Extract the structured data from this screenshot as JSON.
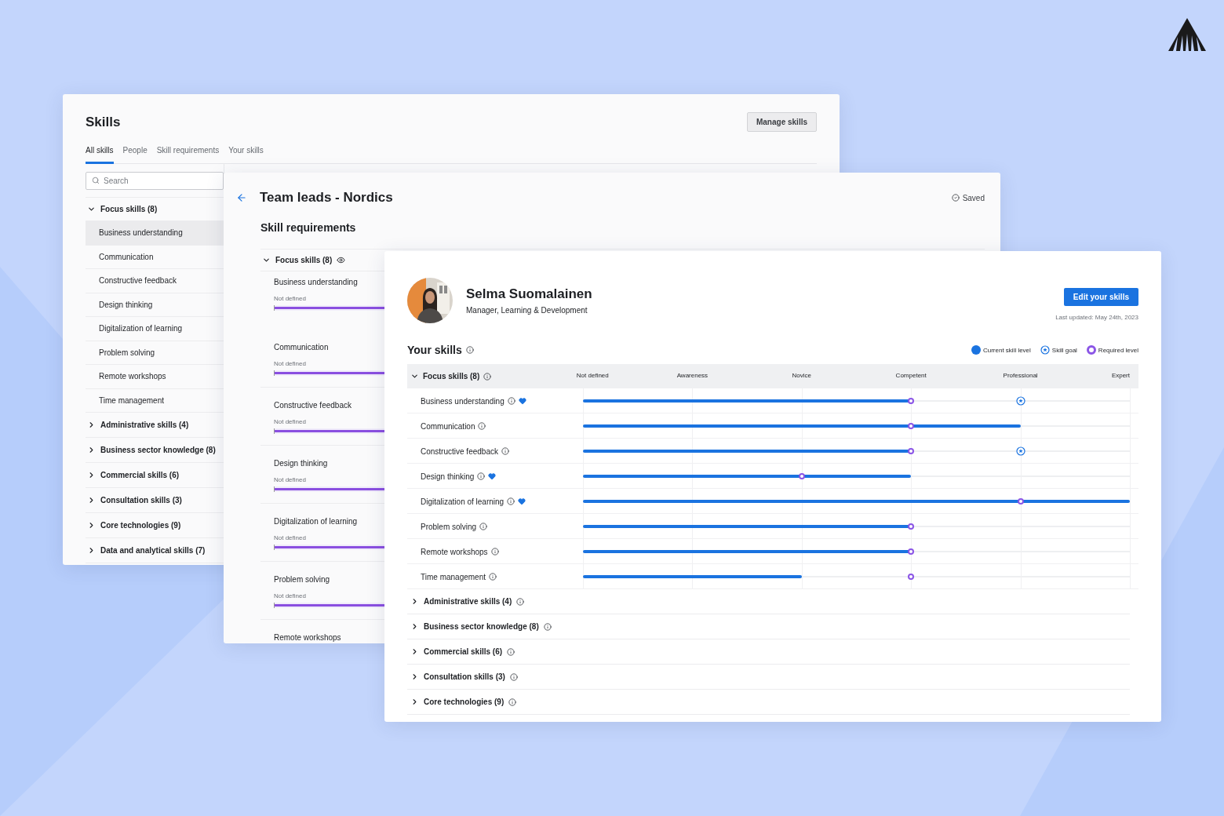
{
  "skills_window": {
    "title": "Skills",
    "manage_button": "Manage skills",
    "tabs": [
      {
        "label": "All skills",
        "selected": true
      },
      {
        "label": "People",
        "selected": false
      },
      {
        "label": "Skill requirements",
        "selected": false
      },
      {
        "label": "Your skills",
        "selected": false
      }
    ],
    "search": {
      "placeholder": "Search"
    },
    "groups": [
      {
        "label": "Focus skills (8)",
        "expanded": true,
        "items": [
          {
            "label": "Business understanding",
            "selected": true
          },
          {
            "label": "Communication",
            "selected": false
          },
          {
            "label": "Constructive feedback",
            "selected": false
          },
          {
            "label": "Design thinking",
            "selected": false
          },
          {
            "label": "Digitalization of learning",
            "selected": false
          },
          {
            "label": "Problem solving",
            "selected": false
          },
          {
            "label": "Remote workshops",
            "selected": false
          },
          {
            "label": "Time management",
            "selected": false
          }
        ]
      },
      {
        "label": "Administrative skills (4)",
        "expanded": false
      },
      {
        "label": "Business sector knowledge (8)",
        "expanded": false
      },
      {
        "label": "Commercial skills (6)",
        "expanded": false
      },
      {
        "label": "Consultation skills (3)",
        "expanded": false
      },
      {
        "label": "Core technologies (9)",
        "expanded": false
      },
      {
        "label": "Data and analytical skills (7)",
        "expanded": false
      }
    ]
  },
  "requirements_window": {
    "title": "Team leads - Nordics",
    "status": "Saved",
    "subtitle": "Skill requirements",
    "group": {
      "label": "Focus skills (8)",
      "expanded": true
    },
    "items": [
      {
        "name": "Business understanding",
        "value": "Not defined",
        "level": 1
      },
      {
        "name": "Communication",
        "value": "Not defined",
        "level": 1
      },
      {
        "name": "Constructive feedback",
        "value": "Not defined",
        "level": 1
      },
      {
        "name": "Design thinking",
        "value": "Not defined",
        "level": 1
      },
      {
        "name": "Digitalization of learning",
        "value": "Not defined",
        "level": 1
      },
      {
        "name": "Problem solving",
        "value": "Not defined",
        "level": 1
      },
      {
        "name": "Remote workshops"
      }
    ]
  },
  "profile_window": {
    "name": "Selma Suomalainen",
    "role": "Manager, Learning & Development",
    "edit_button": "Edit your skills",
    "last_updated": "Last updated: May 24th, 2023",
    "section_title": "Your skills",
    "legend": [
      {
        "kind": "current",
        "label": "Current skill level"
      },
      {
        "kind": "goal",
        "label": "Skill goal"
      },
      {
        "kind": "required",
        "label": "Required level"
      }
    ],
    "scale": [
      "Not defined",
      "Awareness",
      "Novice",
      "Competent",
      "Professional",
      "Expert"
    ],
    "groups": [
      {
        "label": "Focus skills (8)",
        "expanded": true,
        "skills": [
          {
            "name": "Business understanding",
            "favorite": true,
            "level": 0.6,
            "goal": {
              "level": 0.8
            },
            "required": {
              "level": 0.6
            }
          },
          {
            "name": "Communication",
            "favorite": false,
            "level": 0.8,
            "required": {
              "level": 0.6
            }
          },
          {
            "name": "Constructive feedback",
            "favorite": false,
            "level": 0.6,
            "goal": {
              "level": 0.8
            },
            "required": {
              "level": 0.6
            }
          },
          {
            "name": "Design thinking",
            "favorite": true,
            "level": 0.6,
            "required": {
              "level": 0.4
            }
          },
          {
            "name": "Digitalization of learning",
            "favorite": true,
            "level": 1,
            "required": {
              "level": 0.8
            }
          },
          {
            "name": "Problem solving",
            "favorite": false,
            "level": 0.6,
            "required": {
              "level": 0.6
            }
          },
          {
            "name": "Remote workshops",
            "favorite": false,
            "level": 0.6,
            "required": {
              "level": 0.6
            }
          },
          {
            "name": "Time management",
            "favorite": false,
            "level": 0.4,
            "required": {
              "level": 0.6
            }
          }
        ]
      },
      {
        "label": "Administrative skills (4)",
        "expanded": false
      },
      {
        "label": "Business sector knowledge (8)",
        "expanded": false
      },
      {
        "label": "Commercial skills (6)",
        "expanded": false
      },
      {
        "label": "Consultation skills (3)",
        "expanded": false
      },
      {
        "label": "Core technologies (9)",
        "expanded": false
      }
    ]
  }
}
